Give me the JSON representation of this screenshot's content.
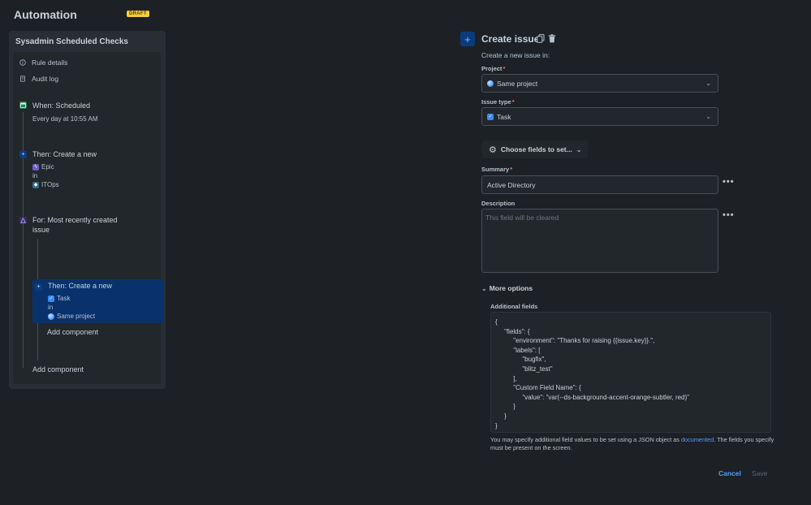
{
  "header": {
    "title": "Automation",
    "badge": "DRAFT"
  },
  "sidebar": {
    "rule_name": "Sysadmin Scheduled Checks",
    "links": [
      {
        "label": "Rule details",
        "icon": "info-icon"
      },
      {
        "label": "Audit log",
        "icon": "document-icon"
      }
    ],
    "steps": {
      "trigger": {
        "title": "When: Scheduled",
        "detail": "Every day at 10:55 AM"
      },
      "action1": {
        "title": "Then: Create a new",
        "type": "Epic",
        "in": "in",
        "project": "ITOps"
      },
      "branch": {
        "title_line1": "For: Most recently created",
        "title_line2": "issue"
      },
      "action2": {
        "title": "Then: Create a new",
        "type": "Task",
        "in": "in",
        "project": "Same project"
      },
      "add_inner": "Add component",
      "add_outer": "Add component"
    }
  },
  "form": {
    "title": "Create issue",
    "subtitle": "Create a new issue in:",
    "project_label": "Project",
    "project_value": "Same project",
    "issue_type_label": "Issue type",
    "issue_type_value": "Task",
    "choose_fields": "Choose fields to set...",
    "summary_label": "Summary",
    "summary_value": "Active Directory",
    "description_label": "Description",
    "description_placeholder": "This field will be cleared",
    "more_options": "More options",
    "additional_fields_label": "Additional fields",
    "json_text": "{\n     \"fields\": {\n          \"environment\": \"Thanks for raising {{issue.key}}.\",\n          \"labels\": [\n               \"bugfix\",\n               \"blitz_test\"\n          ],\n          \"Custom Field Name\": {\n               \"value\": \"var(--ds-background-accent-orange-subtler, red)\"\n          }\n     }\n}",
    "help_pre": "You may specify additional field values to be set using a JSON object as ",
    "help_link": "documented",
    "help_post": ". The fields you specify",
    "help_line2": "must be present on the screen.",
    "cancel": "Cancel",
    "save": "Save",
    "required_mark": "*"
  },
  "colors": {
    "background": "#1d2125",
    "link": "#579dff",
    "selected": "#09326c",
    "draft": "#f5cd47"
  }
}
